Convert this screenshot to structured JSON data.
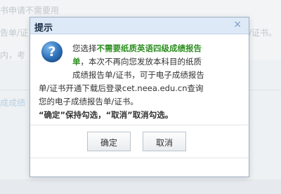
{
  "background": {
    "line1": "书申请不需要用",
    "line2": "告单/证",
    "line3": "内，考",
    "right_text": "/证书。",
    "section_label": "成成绩"
  },
  "dialog": {
    "title": "提示",
    "close": "×",
    "msg_prefix": "您选择",
    "msg_highlight1": "不需要纸质英语四级成绩报告",
    "msg_highlight2": "单",
    "msg_line2_rest": "，本次不再向您发放本科目的纸质",
    "msg_line3": "成绩报告单/证书，可于电子成绩报告",
    "msg_line4": "单/证书开通下载后登录cet.neea.edu.cn查询",
    "msg_line5": "您的电子成绩报告单/证书。",
    "msg_line6": "“确定”保持勾选，“取消”取消勾选。",
    "ok_label": "确定",
    "cancel_label": "取消"
  }
}
